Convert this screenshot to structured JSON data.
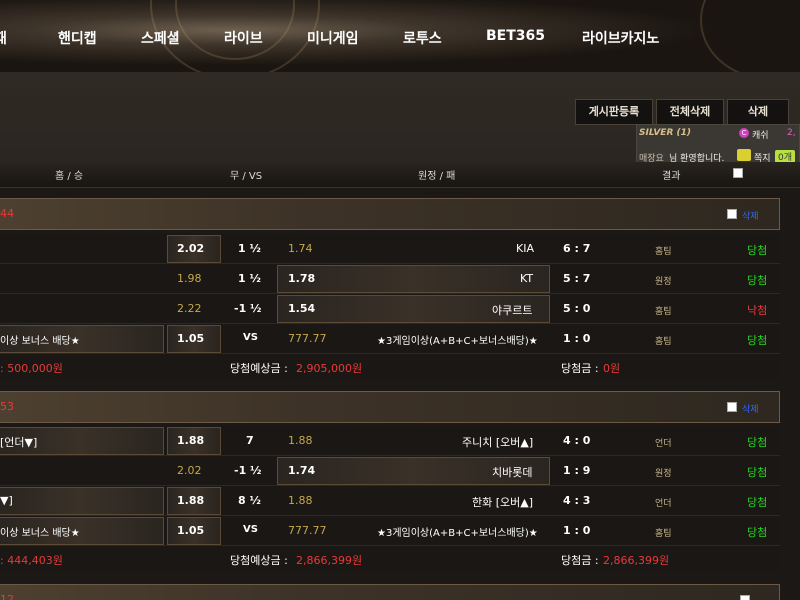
{
  "nav": [
    "패",
    "핸디캡",
    "스페셜",
    "라이브",
    "미니게임",
    "로투스",
    "BET365",
    "라이브카지노"
  ],
  "toolbar": {
    "board": "게시판등록",
    "del_all": "전체삭제",
    "del": "삭제"
  },
  "status": {
    "grade": "SILVER (1)",
    "cash_label": "캐쉬",
    "cash_value": "2,",
    "greet_name": "매장요",
    "greet": "님 환영합니다.",
    "note_label": "쪽지",
    "note_count": "0개"
  },
  "head": {
    "home": "홈 / 승",
    "draw": "무 / VS",
    "away": "원정 / 패",
    "result": "결과"
  },
  "groups": [
    {
      "num": "44",
      "delete": "삭제",
      "rows": [
        {
          "home": "",
          "h_odd": "2.02",
          "mid": "1 ½",
          "a_odd": "1.74",
          "away": "KIA",
          "score": "6 : 7",
          "type": "홈팀",
          "res": "당첨"
        },
        {
          "home": "",
          "h_odd": "1.98",
          "mid": "1 ½",
          "a_odd": "1.78",
          "away": "KT",
          "score": "5 : 7",
          "type": "원정",
          "res": "당첨"
        },
        {
          "home": "",
          "h_odd": "2.22",
          "mid": "-1 ½",
          "a_odd": "1.54",
          "away": "야쿠르트",
          "score": "5 : 0",
          "type": "홈팀",
          "res": "낙첨"
        },
        {
          "home": "이상 보너스 배당★",
          "h_odd": "1.05",
          "mid": "VS",
          "a_odd": "777.77",
          "away": "★3게임이상(A+B+C+보너스배당)★",
          "score": "1 : 0",
          "type": "홈팀",
          "res": "당첨"
        }
      ],
      "bet": ": 500,000원",
      "exp_label": "당첨예상금 : ",
      "exp": "2,905,000원",
      "win_label": "당첨금 : ",
      "win": "0원"
    },
    {
      "num": "53",
      "delete": "삭제",
      "rows": [
        {
          "home": "[언더▼]",
          "h_odd": "1.88",
          "mid": "7",
          "a_odd": "1.88",
          "away": "주니치 [오버▲]",
          "score": "4 : 0",
          "type": "언더",
          "res": "당첨"
        },
        {
          "home": "",
          "h_odd": "2.02",
          "mid": "-1 ½",
          "a_odd": "1.74",
          "away": "치바롯데",
          "score": "1 : 9",
          "type": "원정",
          "res": "당첨"
        },
        {
          "home": "▼]",
          "h_odd": "1.88",
          "mid": "8 ½",
          "a_odd": "1.88",
          "away": "한화 [오버▲]",
          "score": "4 : 3",
          "type": "언더",
          "res": "당첨"
        },
        {
          "home": "이상 보너스 배당★",
          "h_odd": "1.05",
          "mid": "VS",
          "a_odd": "777.77",
          "away": "★3게임이상(A+B+C+보너스배당)★",
          "score": "1 : 0",
          "type": "홈팀",
          "res": "당첨"
        }
      ],
      "bet": ": 444,403원",
      "exp_label": "당첨예상금 : ",
      "exp": "2,866,399원",
      "win_label": "당첨금 : ",
      "win": "2,866,399원"
    },
    {
      "num": "12"
    }
  ]
}
